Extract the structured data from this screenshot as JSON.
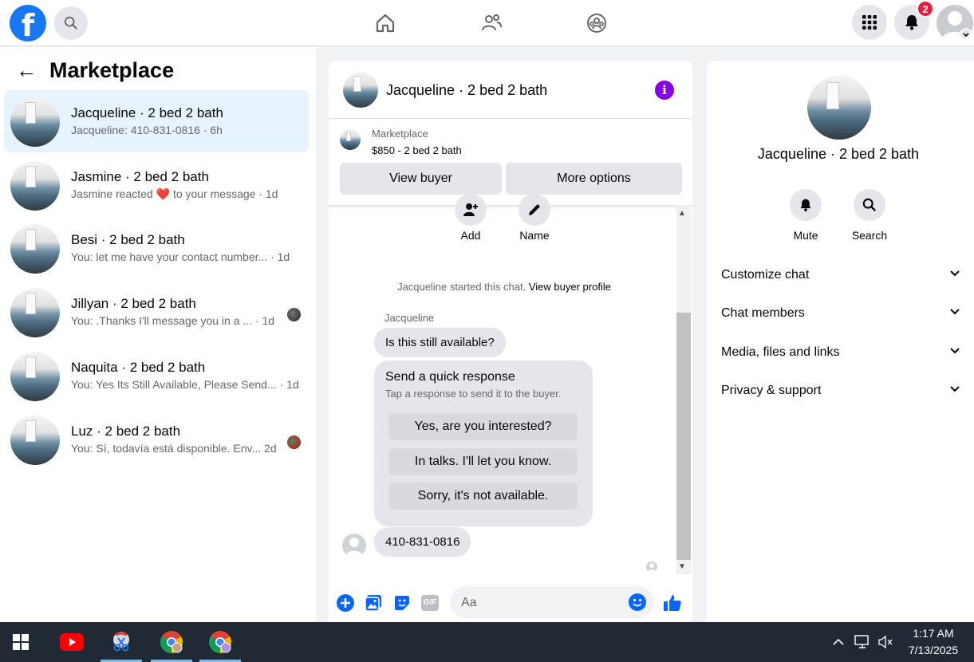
{
  "app": {
    "logo_letter": "f",
    "notifications_count": "2"
  },
  "left_panel": {
    "title": "Marketplace",
    "conversations": [
      {
        "name": "Jacqueline · 2 bed 2 bath",
        "preview": "Jacqueline: 410-831-0816 · 6h",
        "active": true
      },
      {
        "name": "Jasmine · 2 bed 2 bath",
        "preview_before": "Jasmine reacted",
        "preview_after": "to your message · 1d"
      },
      {
        "name": "Besi · 2 bed 2 bath",
        "preview": "You: let me have your contact number... · 1d"
      },
      {
        "name": "Jillyan · 2 bed 2 bath",
        "preview": "You: .Thanks I'll message you in a ...   · 1d"
      },
      {
        "name": "Naquita · 2 bed 2 bath",
        "preview": "You: Yes Its Still Available, Please Send... · 1d"
      },
      {
        "name": "Luz · 2 bed 2 bath",
        "preview": "You: Sí, todavía está disponible. Env...  2d"
      }
    ]
  },
  "chat": {
    "title": "Jacqueline · 2 bed 2 bath",
    "marketplace_label": "Marketplace",
    "listing": "$850 - 2 bed 2 bath",
    "view_buyer": "View buyer",
    "more_options": "More options",
    "actions": {
      "add": "Add",
      "name": "Name"
    },
    "system_message": "Jacqueline started this chat.",
    "system_link": "View buyer profile",
    "sender": "Jacqueline",
    "message_1": "Is this still available?",
    "quick_response": {
      "title": "Send a quick response",
      "subtitle": "Tap a response to send it to the buyer.",
      "options": [
        "Yes, are you interested?",
        "In talks. I'll let you know.",
        "Sorry, it's not available."
      ]
    },
    "message_2": "410-831-0816",
    "composer_placeholder": "Aa",
    "gif_label": "GIF"
  },
  "right_panel": {
    "name": "Jacqueline · 2 bed 2 bath",
    "mute": "Mute",
    "search": "Search",
    "sections": [
      "Customize chat",
      "Chat members",
      "Media, files and links",
      "Privacy & support"
    ]
  },
  "taskbar": {
    "time": "1:17 AM",
    "date": "7/13/2025"
  },
  "colors": {
    "facebook_blue": "#1877f2",
    "active_row": "#e7f3ff",
    "info_purple": "#8a00e6",
    "badge_red": "#e41e3f"
  }
}
